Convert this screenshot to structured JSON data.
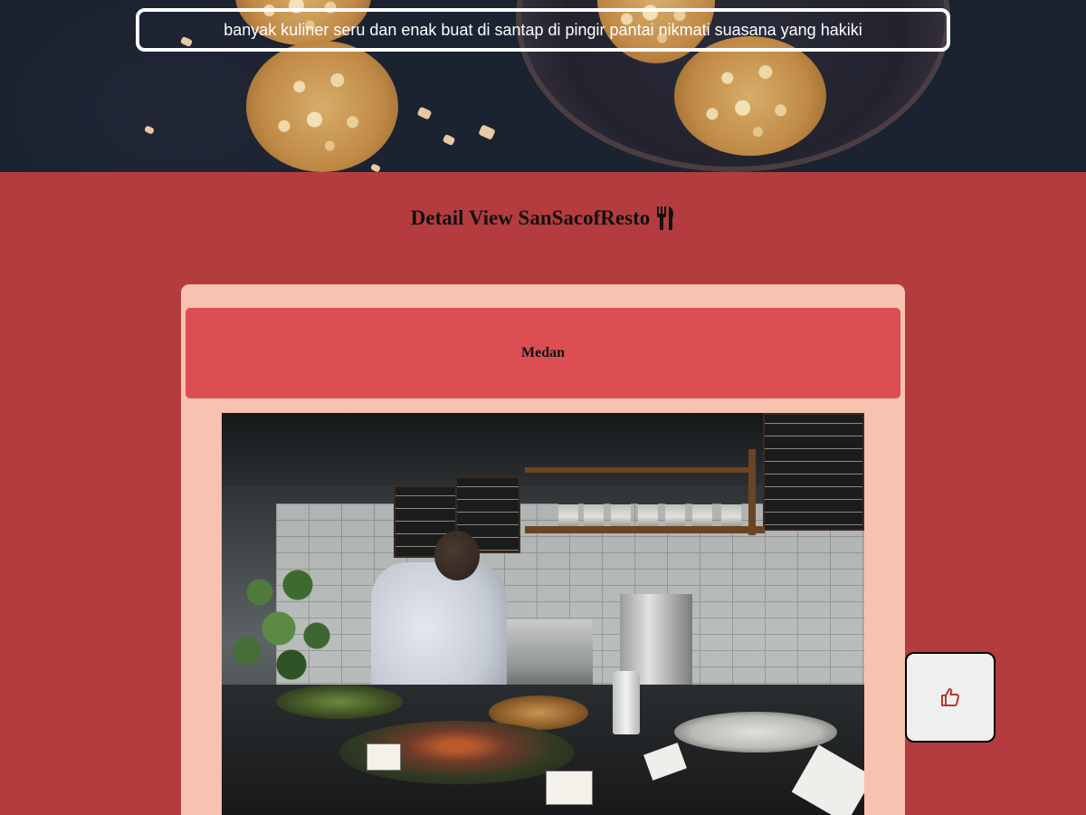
{
  "hero": {
    "tagline": "banyak kuliner seru dan enak buat di santap di pingir pantai nikmati suasana yang hakiki"
  },
  "page": {
    "title": "Detail View SanSacofResto",
    "title_icon": "utensils-icon"
  },
  "restaurant": {
    "city": "Medan",
    "image_icon": "restaurant-kitchen-photo"
  },
  "like_button": {
    "icon": "thumbs-up-icon"
  },
  "colors": {
    "page_background": "#b43c3e",
    "card_background": "#f7c2b0",
    "city_banner": "#db4f52",
    "like_icon": "#b33a2c"
  }
}
